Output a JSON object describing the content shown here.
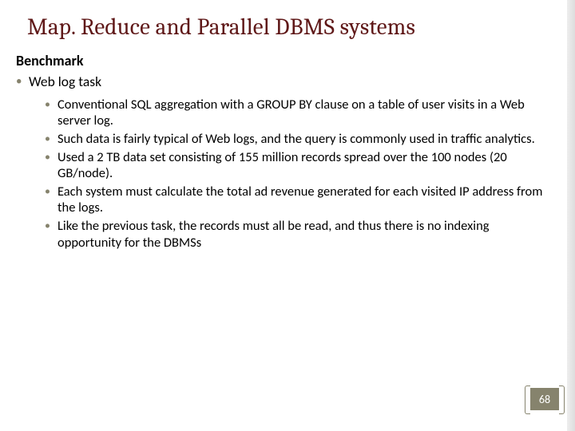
{
  "title": "Map. Reduce and Parallel DBMS systems",
  "subheading": "Benchmark",
  "level1": {
    "label": "Web log task"
  },
  "bullets": [
    "Conventional SQL aggregation with a GROUP BY clause on a table of user visits in a Web server log.",
    "Such data is fairly typical of Web logs, and the query is commonly used in traffic analytics.",
    "Used a 2 TB data set consisting of 155 million records spread over the 100 nodes (20 GB/node).",
    "Each system must calculate the total ad revenue generated for each visited IP address from the logs.",
    "Like the previous task, the records must all be read, and thus there is no indexing opportunity for the DBMSs"
  ],
  "page_number": "68",
  "accent_color": "#86836d",
  "title_color": "#5f1818"
}
